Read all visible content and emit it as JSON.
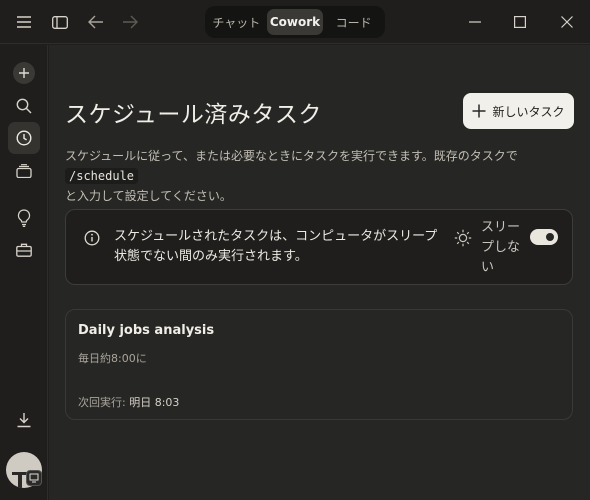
{
  "titlebar": {
    "icons": [
      "menu-icon",
      "sidebar-toggle-icon",
      "back-arrow-icon",
      "forward-arrow-icon"
    ],
    "modes": [
      "チャット",
      "Cowork",
      "コード"
    ],
    "active_mode": "Cowork",
    "window_controls": [
      "minimize-icon",
      "maximize-icon",
      "close-icon"
    ]
  },
  "sidebar": {
    "items": [
      "new-icon",
      "search-icon",
      "clock-icon",
      "stack-icon",
      "lightbulb-icon",
      "briefcase-icon",
      "download-icon"
    ],
    "active": "clock-icon"
  },
  "main": {
    "title": "スケジュール済みタスク",
    "new_task_label": "新しいタスク",
    "desc_part1": "スケジュールに従って、または必要なときにタスクを実行できます。既存のタスクで ",
    "desc_code": "/schedule",
    "desc_part2": "と入力して設定してください。",
    "info_text": "スケジュールされたタスクは、コンピュータがスリープ状態でない間のみ実行されます。",
    "sleep_label": "スリープしない",
    "sleep_toggle_on": true
  },
  "tasks": [
    {
      "name": "Daily jobs analysis",
      "schedule": "毎日約8:00に",
      "next_prefix": "次回実行:",
      "next_value": "明日 8:03"
    }
  ],
  "colors": {
    "background": "#262624",
    "sidebar": "#1f1e1c",
    "button_light": "#f2f0ea",
    "text": "#e9e6df"
  }
}
